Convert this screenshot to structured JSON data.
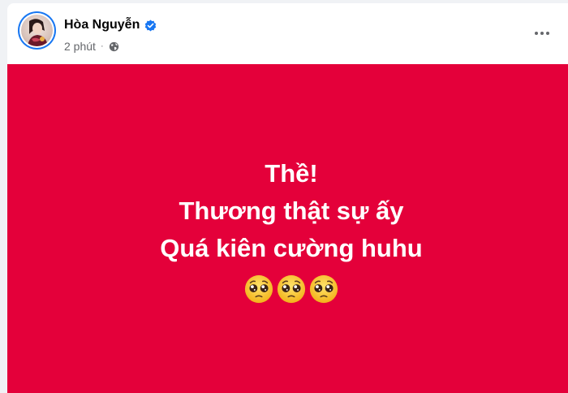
{
  "post": {
    "author_name": "Hòa Nguyễn",
    "verified": true,
    "timestamp": "2 phút",
    "separator": "·",
    "privacy_icon": "globe-icon",
    "more_icon": "more-options-icon",
    "background_color": "#e4003a",
    "text_color": "#ffffff",
    "lines": [
      "Thề!",
      "Thương thật sự ấy",
      "Quá kiên cường huhu"
    ],
    "emojis": [
      "pleading-face-emoji",
      "pleading-face-emoji",
      "pleading-face-emoji"
    ]
  }
}
